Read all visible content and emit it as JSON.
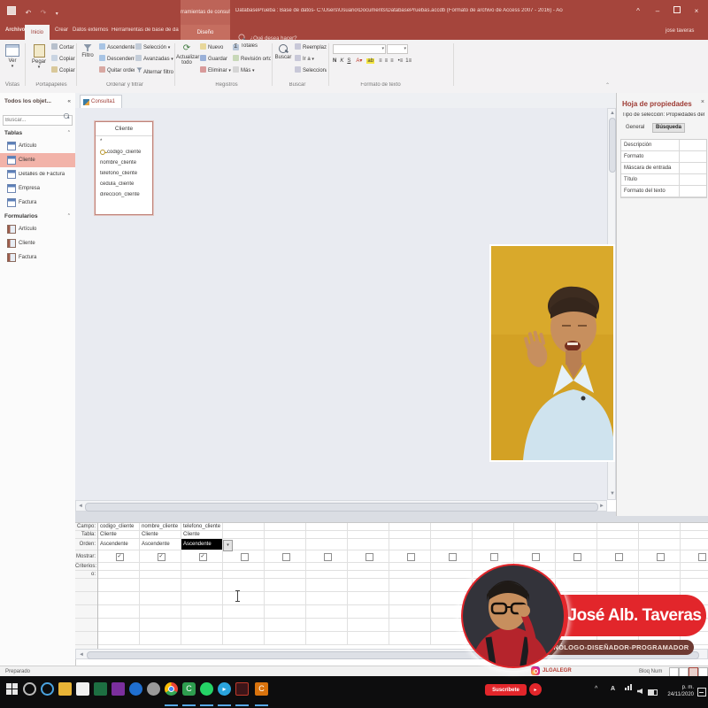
{
  "titlebar": {
    "contextual_label": "Herramientas de consultas",
    "title": "DatabasePrueba : Base de datos- C:\\Users\\Usuario\\Documents\\DatabasePruebas.accdb (Formato de archivo de Access 2007 - 2016) - Access [Error (límite de activación de producto)]",
    "user": "jose taveras"
  },
  "ribbon_tabs": {
    "archivo": "Archivo",
    "inicio": "Inicio",
    "crear": "Crear",
    "datos_externos": "Datos externos",
    "herramientas": "Herramientas de base de datos",
    "diseno": "Diseño",
    "search": "¿Qué desea hacer?"
  },
  "ribbon": {
    "ver": "Ver",
    "vistas": "Vistas",
    "pegar": "Pegar",
    "cortar": "Cortar",
    "copiar": "Copiar",
    "copiar_formato": "Copiar formato",
    "portapapeles": "Portapapeles",
    "filtro": "Filtro",
    "ascendente": "Ascendente",
    "descendente": "Descendente",
    "quitar_orden": "Quitar orden",
    "seleccion": "Selección",
    "avanzadas": "Avanzadas",
    "alternar_filtro": "Alternar filtro",
    "ordenar_y_filtrar": "Ordenar y filtrar",
    "actualizar_todo": "Actualizar todo",
    "nuevo": "Nuevo",
    "guardar": "Guardar",
    "eliminar": "Eliminar",
    "totales": "Totales",
    "revision": "Revisión ortográfica",
    "mas": "Más",
    "registros": "Registros",
    "buscar": "Buscar",
    "reemplazar": "Reemplazar",
    "ir_a": "Ir a",
    "seleccionar": "Seleccionar",
    "buscar_grupo": "Buscar",
    "bold": "N",
    "italic": "K",
    "underline": "S",
    "formato_de_texto": "Formato de texto"
  },
  "nav": {
    "header": "Todos los objet...",
    "search_placeholder": "Buscar...",
    "groups": [
      {
        "label": "Tablas",
        "items": [
          "Artículo",
          "Cliente",
          "Detalles de Factura",
          "Empresa",
          "Factura"
        ]
      },
      {
        "label": "Formularios",
        "items": [
          "Artículo",
          "Cliente",
          "Factura"
        ]
      }
    ]
  },
  "doc": {
    "tab": "Consulta1",
    "fieldlist": {
      "title": "Cliente",
      "fields": [
        "*",
        "codigo_cliente",
        "nombre_cliente",
        "telefono_cliente",
        "cedula_cliente",
        "direccion_cliente"
      ]
    }
  },
  "qbe": {
    "row_labels": [
      "Campo:",
      "Tabla:",
      "Orden:",
      "Mostrar:",
      "Criterios:",
      "o:"
    ],
    "columns": [
      {
        "campo": "codigo_cliente",
        "tabla": "Cliente",
        "orden": "Ascendente",
        "mostrar": true
      },
      {
        "campo": "nombre_cliente",
        "tabla": "Cliente",
        "orden": "Ascendente",
        "mostrar": true
      },
      {
        "campo": "telefono_cliente",
        "tabla": "Cliente",
        "orden": "Ascendente",
        "mostrar": true
      }
    ]
  },
  "props": {
    "title": "Hoja de propiedades",
    "subtitle": "Tipo de selección: Propiedades del campo",
    "tab_general": "General",
    "tab_busqueda": "Búsqueda",
    "rows": [
      "Descripción",
      "Formato",
      "Máscara de entrada",
      "Título",
      "Formato del texto"
    ]
  },
  "status": {
    "left": "Preparado",
    "lock": "Bloq Num"
  },
  "overlay": {
    "name": "José Alb. Taveras",
    "role": "TECNÓLOGO-DISEÑADOR-PROGRAMADOR",
    "handle": "JLGALEGR",
    "subscribe": "Suscríbete"
  },
  "tray": {
    "lang": "A",
    "ampm": "p. m.",
    "date": "24/11/2020"
  },
  "colors": {
    "accent": "#a5453c",
    "banner_red": "#e2262b",
    "banner_dark": "#6e3b33",
    "webcam_yellow": "#d3a124",
    "nav_selected": "#f2b3a9"
  }
}
